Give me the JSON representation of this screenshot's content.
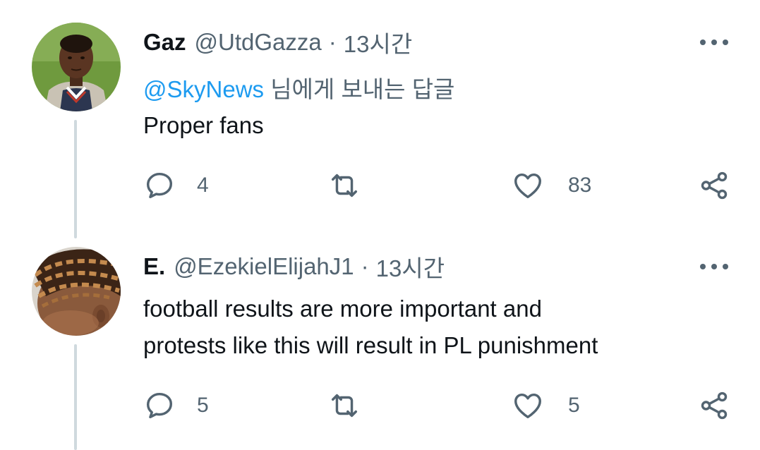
{
  "tweets": [
    {
      "name": "Gaz",
      "handle": "@UtdGazza",
      "separator": "·",
      "time": "13시간",
      "reply_to_handle": "@SkyNews",
      "reply_to_suffix": " 님에게 보내는 답글",
      "text_lines": [
        "Proper fans"
      ],
      "replies": "4",
      "retweets": "",
      "likes": "83",
      "icons": [
        "avatar-photo",
        "more-icon",
        "reply-icon",
        "retweet-icon",
        "like-icon",
        "share-icon"
      ]
    },
    {
      "name": "E.",
      "handle": "@EzekielElijahJ1",
      "separator": "·",
      "time": "13시간",
      "text_lines": [
        "football results are more important and",
        "protests like this will result in PL punishment"
      ],
      "replies": "5",
      "retweets": "",
      "likes": "5",
      "icons": [
        "avatar-photo",
        "more-icon",
        "reply-icon",
        "retweet-icon",
        "like-icon",
        "share-icon"
      ]
    }
  ],
  "colors": {
    "text": "#0f1419",
    "secondary": "#536471",
    "link": "#1d9bf0",
    "thread_line": "#cfd9de"
  }
}
